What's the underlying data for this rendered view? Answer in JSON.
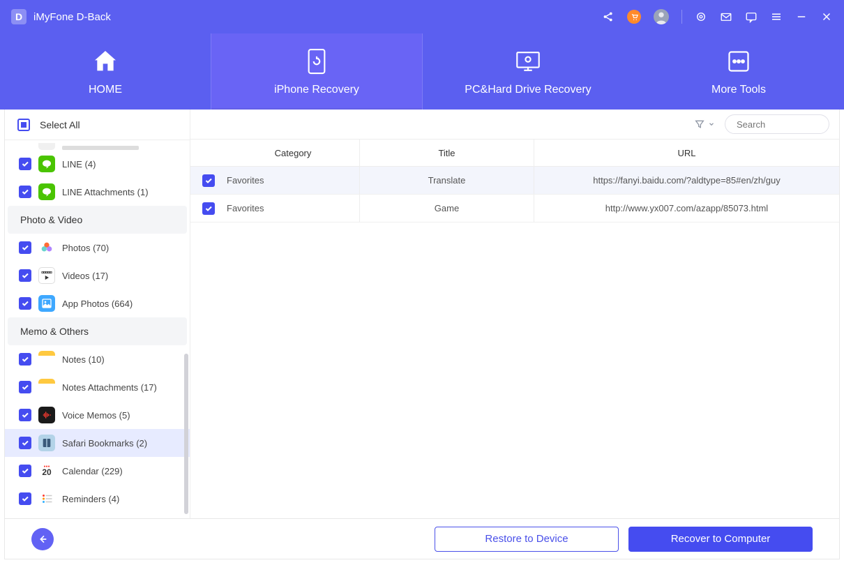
{
  "app": {
    "logo_letter": "D",
    "title": "iMyFone D-Back"
  },
  "nav": {
    "home": "HOME",
    "iphone": "iPhone Recovery",
    "pc": "PC&Hard Drive Recovery",
    "tools": "More Tools"
  },
  "sidebar": {
    "select_all": "Select All",
    "items": [
      {
        "label": "LINE (4)",
        "icon_bg": "#17c84a",
        "icon": "line"
      },
      {
        "label": "LINE Attachments (1)",
        "icon_bg": "#17c84a",
        "icon": "line"
      }
    ],
    "section_photo": "Photo & Video",
    "photo_items": [
      {
        "label": "Photos (70)",
        "icon": "photos"
      },
      {
        "label": "Videos (17)",
        "icon": "videos"
      },
      {
        "label": "App Photos (664)",
        "icon": "appphotos"
      }
    ],
    "section_memo": "Memo & Others",
    "memo_items": [
      {
        "label": "Notes (10)",
        "icon": "notes"
      },
      {
        "label": "Notes Attachments (17)",
        "icon": "notes"
      },
      {
        "label": "Voice Memos (5)",
        "icon": "voicememos"
      },
      {
        "label": "Safari Bookmarks (2)",
        "icon": "safari",
        "selected": true
      },
      {
        "label": "Calendar (229)",
        "icon": "calendar",
        "cal_text": "20"
      },
      {
        "label": "Reminders (4)",
        "icon": "reminders"
      }
    ]
  },
  "toolbar": {
    "search_placeholder": "Search"
  },
  "table": {
    "headers": {
      "category": "Category",
      "title": "Title",
      "url": "URL"
    },
    "rows": [
      {
        "category": "Favorites",
        "title": "Translate",
        "url": "https://fanyi.baidu.com/?aldtype=85#en/zh/guy",
        "highlight": true
      },
      {
        "category": "Favorites",
        "title": "Game",
        "url": "http://www.yx007.com/azapp/85073.html",
        "highlight": false
      }
    ]
  },
  "footer": {
    "restore": "Restore to Device",
    "recover": "Recover to Computer"
  }
}
